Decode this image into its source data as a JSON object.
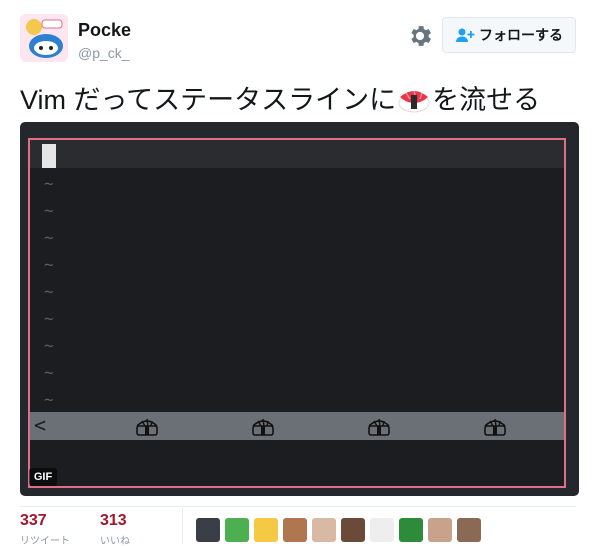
{
  "user": {
    "display_name": "Pocke",
    "username": "@p_ck_",
    "follow_label": "フォローする"
  },
  "tweet": {
    "text_before": "Vim だってステータスラインに",
    "text_after": "を流せる",
    "emoji": "sushi-emoji"
  },
  "media": {
    "gif_label": "GIF",
    "status_chevron": "<",
    "tilde": "~"
  },
  "stats": {
    "retweets_count": "337",
    "retweets_label": "リツイート",
    "likes_count": "313",
    "likes_label": "いいね"
  },
  "colors": {
    "accent": "#a0172e",
    "vim_border": "#e0708a",
    "statusline": "#6b7076"
  }
}
